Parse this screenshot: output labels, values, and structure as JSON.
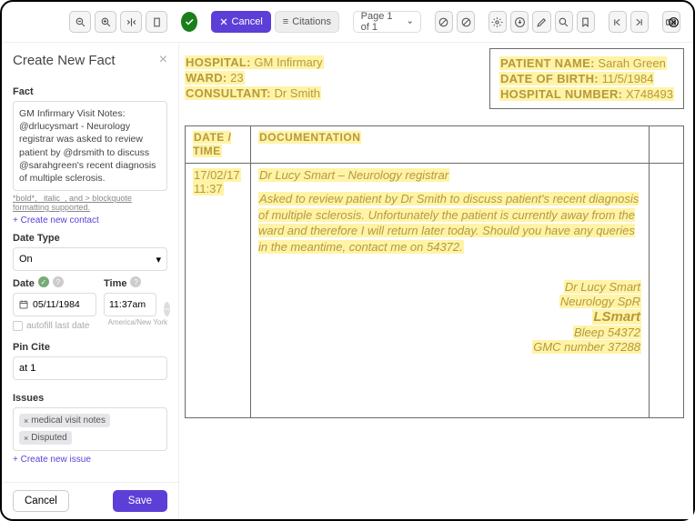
{
  "toolbar": {
    "cancel": "Cancel",
    "citations": "Citations",
    "page_label": "Page 1 of 1"
  },
  "sidebar": {
    "title": "Create New Fact",
    "fact": {
      "label": "Fact",
      "text": "GM Infirmary Visit Notes: @drlucysmart - Neurology registrar was asked to review patient by @drsmith to discuss @sarahgreen's recent diagnosis of multiple sclerosis.",
      "helper": "*bold*, _italic_, and > blockquote formatting supported.",
      "new_contact": "+ Create new contact"
    },
    "date_type": {
      "label": "Date Type",
      "value": "On"
    },
    "date": {
      "label": "Date",
      "value": "05/11/1984",
      "autofill": "autofill last date"
    },
    "time": {
      "label": "Time",
      "value": "11:37am",
      "tz": "America/New York"
    },
    "pin_cite": {
      "label": "Pin Cite",
      "value": "at 1"
    },
    "issues": {
      "label": "Issues",
      "tags": [
        "medical visit notes",
        "Disputed"
      ],
      "new_issue": "+ Create new issue"
    },
    "buttons": {
      "cancel": "Cancel",
      "save": "Save"
    }
  },
  "document": {
    "header_left": {
      "hospital_k": "HOSPITAL:",
      "hospital_v": "GM Infirmary",
      "ward_k": "WARD:",
      "ward_v": "23",
      "consultant_k": "CONSULTANT:",
      "consultant_v": "Dr Smith"
    },
    "patient_box": {
      "name_k": "PATIENT NAME:",
      "name_v": "Sarah Green",
      "dob_k": "DATE OF BIRTH:",
      "dob_v": "11/5/1984",
      "num_k": "HOSPITAL NUMBER:",
      "num_v": "X748493"
    },
    "table": {
      "col_dt": "DATE / TIME",
      "col_doc": "DOCUMENTATION",
      "entry": {
        "date": "17/02/17",
        "time": "11:37",
        "head": "Dr Lucy Smart – Neurology registrar",
        "body": "Asked to review patient by Dr Smith to discuss patient's recent diagnosis of multiple sclerosis. Unfortunately the patient is currently away from the ward and therefore I will return later today. Should you have any queries in the meantime, contact me on 54372.",
        "sig": {
          "l1": "Dr Lucy Smart",
          "l2": "Neurology SpR",
          "l3": "LSmart",
          "l4": "Bleep 54372",
          "l5": "GMC number 37288"
        }
      }
    }
  }
}
